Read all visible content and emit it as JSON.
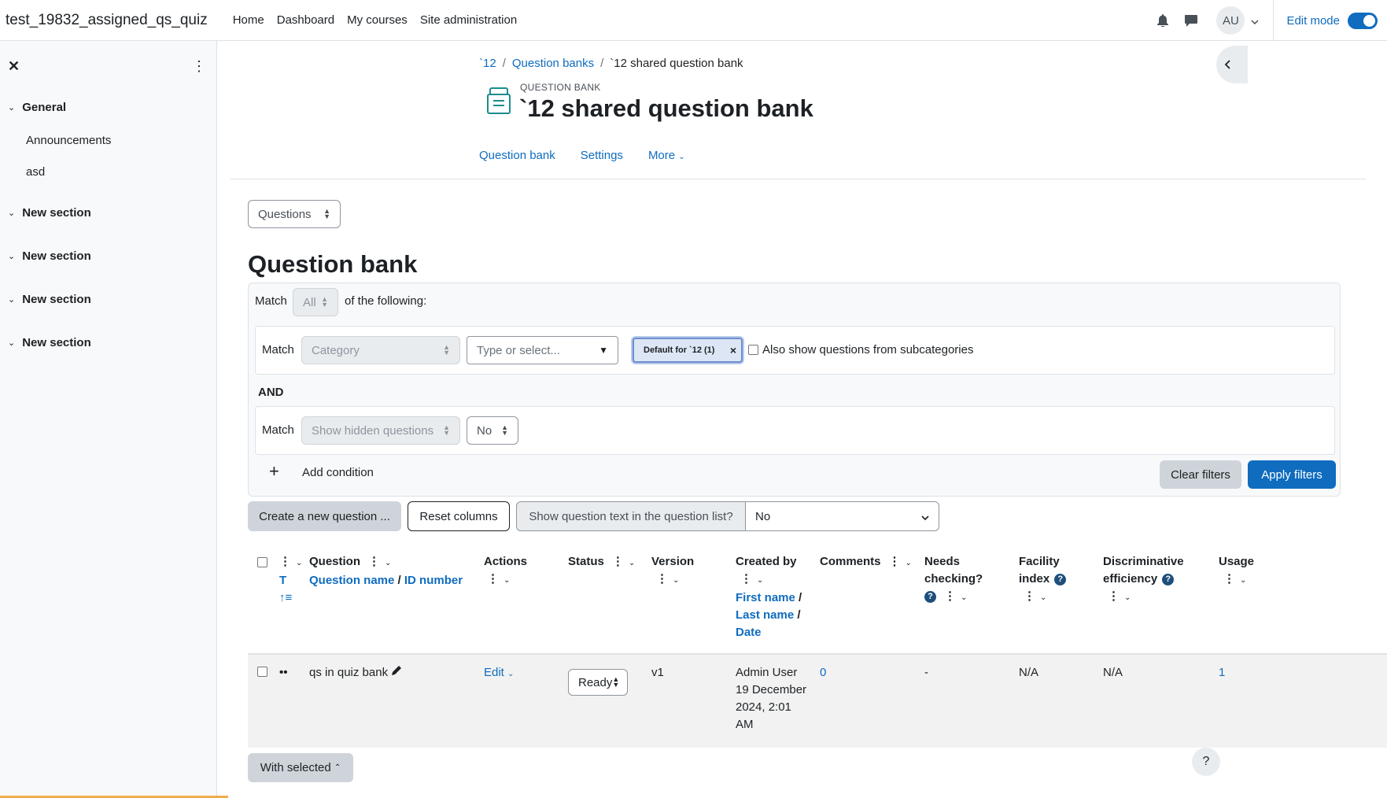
{
  "nav": {
    "brand": "test_19832_assigned_qs_quiz",
    "items": [
      "Home",
      "Dashboard",
      "My courses",
      "Site administration"
    ],
    "avatar": "AU",
    "edit_mode": "Edit mode"
  },
  "drawer": {
    "sections": [
      {
        "label": "General",
        "items": [
          "Announcements",
          "asd"
        ]
      },
      {
        "label": "New section"
      },
      {
        "label": "New section"
      },
      {
        "label": "New section"
      },
      {
        "label": "New section"
      }
    ]
  },
  "breadcrumb": [
    "`12",
    "Question banks",
    "`12 shared question bank"
  ],
  "header": {
    "pre": "QUESTION BANK",
    "title": "`12 shared question bank"
  },
  "secondary_nav": [
    "Question bank",
    "Settings",
    "More"
  ],
  "view_select": "Questions",
  "page_title": "Question bank",
  "filters": {
    "match_label": "Match",
    "match_value": "All",
    "of_following": "of the following:",
    "cond1_match": "Match",
    "cond1_type": "Category",
    "cond1_placeholder": "Type or select...",
    "cond1_chip": "Default for `12 (1)",
    "cond1_subcats": "Also show questions from subcategories",
    "and_label": "AND",
    "cond2_match": "Match",
    "cond2_type": "Show hidden questions",
    "cond2_value": "No",
    "add_condition": "Add condition",
    "clear": "Clear filters",
    "apply": "Apply filters"
  },
  "toolbar": {
    "create": "Create a new question ...",
    "reset": "Reset columns",
    "show_text_label": "Show question text in the question list?",
    "show_text_value": "No"
  },
  "table": {
    "headers": {
      "t": "T",
      "question": "Question",
      "question_name": "Question name",
      "slash": "/",
      "id_number": "ID number",
      "actions": "Actions",
      "status": "Status",
      "version": "Version",
      "created_by": "Created by",
      "first_name": "First name",
      "last_name": "Last name",
      "date": "Date",
      "comments": "Comments",
      "needs_checking_1": "Needs",
      "needs_checking_2": "checking?",
      "facility_1": "Facility",
      "facility_2": "index",
      "disc_1": "Discriminative",
      "disc_2": "efficiency",
      "usage": "Usage"
    },
    "row": {
      "name": "qs in quiz bank",
      "action": "Edit",
      "status": "Ready",
      "version": "v1",
      "created_by_name": "Admin User",
      "created_by_date1": "19 December",
      "created_by_date2": "2024, 2:01",
      "created_by_date3": "AM",
      "comments": "0",
      "needs_checking": "-",
      "facility": "N/A",
      "discriminative": "N/A",
      "usage": "1"
    }
  },
  "with_selected": "With selected",
  "help_fab": "?"
}
